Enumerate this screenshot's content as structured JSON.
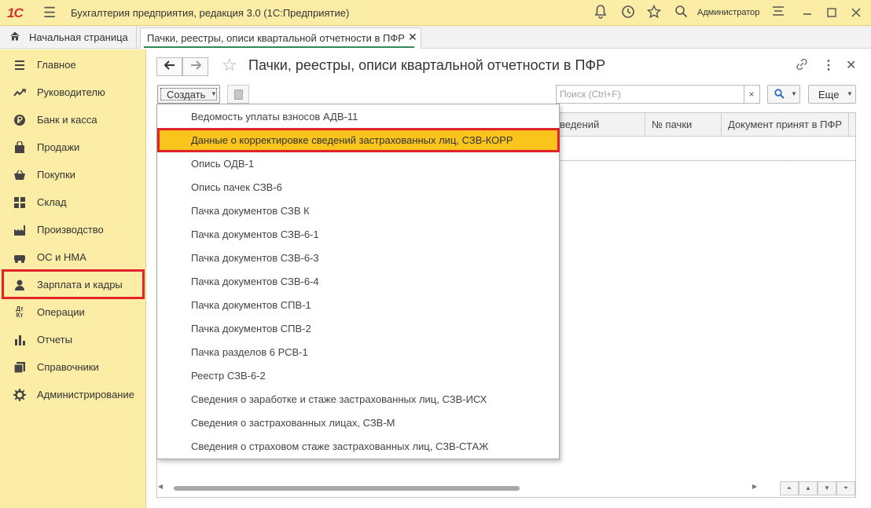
{
  "app": {
    "logo": "1С",
    "title": "Бухгалтерия предприятия, редакция 3.0  (1С:Предприятие)",
    "user": "Администратор"
  },
  "tabs": {
    "home": "Начальная страница",
    "active": "Пачки, реестры, описи квартальной отчетности в ПФР"
  },
  "sidebar": {
    "items": [
      {
        "label": "Главное",
        "icon": "menu-lines-icon"
      },
      {
        "label": "Руководителю",
        "icon": "trend-icon"
      },
      {
        "label": "Банк и касса",
        "icon": "ruble-coin-icon"
      },
      {
        "label": "Продажи",
        "icon": "shopping-bag-icon"
      },
      {
        "label": "Покупки",
        "icon": "basket-icon"
      },
      {
        "label": "Склад",
        "icon": "warehouse-grid-icon"
      },
      {
        "label": "Производство",
        "icon": "factory-icon"
      },
      {
        "label": "ОС и НМА",
        "icon": "assets-icon"
      },
      {
        "label": "Зарплата и кадры",
        "icon": "person-icon"
      },
      {
        "label": "Операции",
        "icon": "debit-credit-icon",
        "glyph": "Дт Кт"
      },
      {
        "label": "Отчеты",
        "icon": "bar-chart-icon"
      },
      {
        "label": "Справочники",
        "icon": "book-icon"
      },
      {
        "label": "Администрирование",
        "icon": "gear-icon"
      }
    ]
  },
  "form": {
    "title": "Пачки, реестры, описи квартальной отчетности в ПФР",
    "create_label": "Создать",
    "search_placeholder": "Поиск (Ctrl+F)",
    "clear_label": "×",
    "more_label": "Еще"
  },
  "grid": {
    "columns": [
      "ведений",
      "№ пачки",
      "Документ принят в ПФР"
    ]
  },
  "dropdown": {
    "items": [
      "Ведомость уплаты взносов АДВ-11",
      "Данные о корректировке сведений застрахованных лиц, СЗВ-КОРР",
      "Опись ОДВ-1",
      "Опись пачек СЗВ-6",
      "Пачка документов СЗВ К",
      "Пачка документов СЗВ-6-1",
      "Пачка документов СЗВ-6-3",
      "Пачка документов СЗВ-6-4",
      "Пачка документов СПВ-1",
      "Пачка документов СПВ-2",
      "Пачка разделов 6 РСВ-1",
      "Реестр СЗВ-6-2",
      "Сведения о заработке и стаже застрахованных лиц, СЗВ-ИСХ",
      "Сведения о застрахованных лицах, СЗВ-М",
      "Сведения о страховом стаже застрахованных лиц, СЗВ-СТАЖ"
    ],
    "selected_index": 1
  },
  "colors": {
    "panel_bg": "#fbeda6",
    "highlight": "#f9c41b",
    "annotation_red": "#e2232a",
    "tab_underline": "#2e8b57"
  }
}
